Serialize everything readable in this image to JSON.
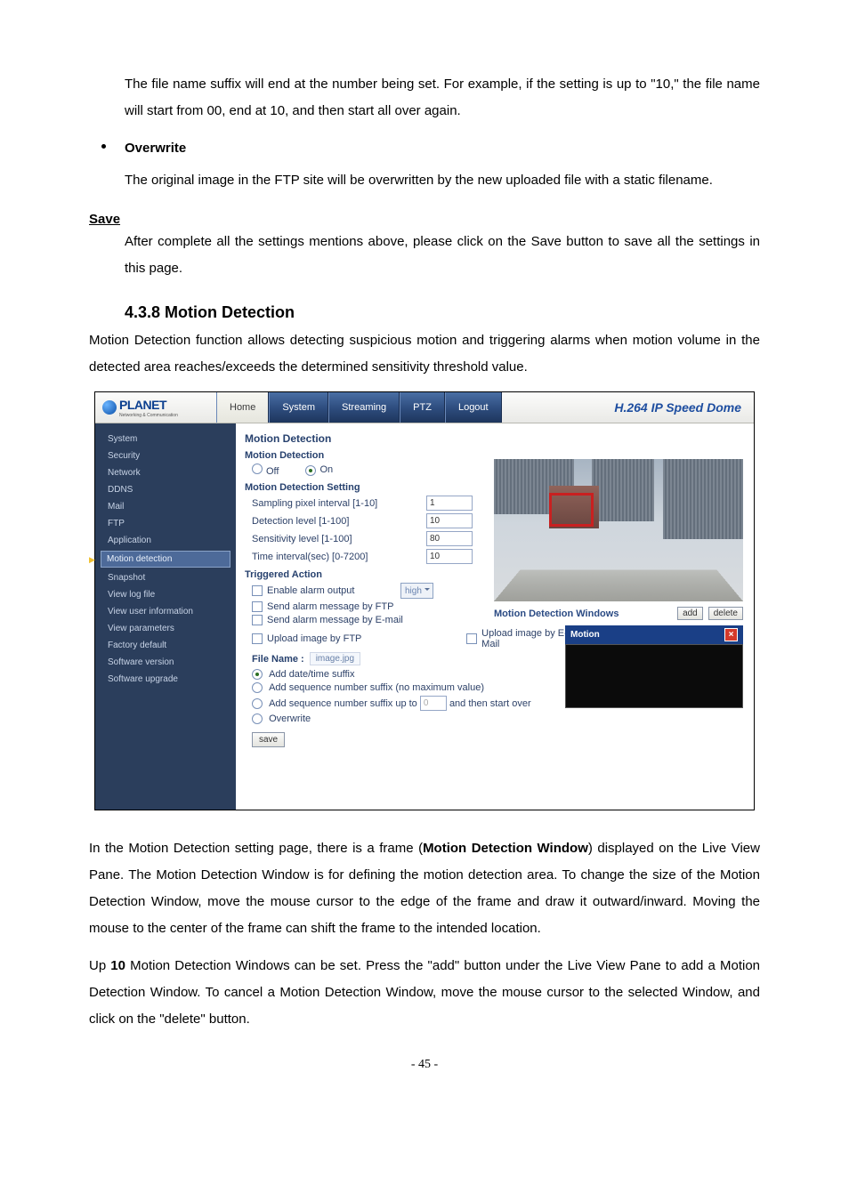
{
  "para1": "The file name suffix will end at the number being set. For example, if the setting is up to \"10,\" the file name will start from 00, end at 10, and then start all over again.",
  "bullet_overwrite": "Overwrite",
  "para_overwrite": "The original image in the FTP site will be overwritten by the new uploaded file with a static filename.",
  "save_h": "Save",
  "para_save": "After complete all the settings mentions above, please click on the Save button to save all the settings in this page.",
  "secnum": "4.3.8  Motion Detection",
  "para_md_intro": "Motion Detection function allows detecting suspicious motion and triggering alarms when motion volume in the detected area reaches/exceeds the determined sensitivity threshold value.",
  "logo": "PLANET",
  "logo_sub": "Networking & Communication",
  "nav": {
    "home": "Home",
    "system": "System",
    "streaming": "Streaming",
    "ptz": "PTZ",
    "logout": "Logout"
  },
  "brand": "H.264 IP Speed Dome",
  "side": [
    "System",
    "Security",
    "Network",
    "DDNS",
    "Mail",
    "FTP",
    "Application",
    "Motion detection",
    "Snapshot",
    "View log file",
    "View user information",
    "View parameters",
    "Factory default",
    "Software version",
    "Software upgrade"
  ],
  "ct": {
    "h1": "Motion Detection",
    "h2": "Motion Detection",
    "off": "Off",
    "on": "On",
    "h3": "Motion Detection Setting",
    "r1": "Sampling pixel interval [1-10]",
    "v1": "1",
    "r2": "Detection level [1-100]",
    "v2": "10",
    "r3": "Sensitivity level [1-100]",
    "v3": "80",
    "r4": "Time interval(sec) [0-7200]",
    "v4": "10",
    "h4": "Triggered Action",
    "c1": "Enable alarm output",
    "sel": "high",
    "c2": "Send alarm message by FTP",
    "c3": "Send alarm message by E-mail",
    "c4": "Upload image by FTP",
    "c5": "Upload image by E-Mail",
    "fn_t": "File Name :",
    "fn_v": "image.jpg",
    "o1": "Add date/time suffix",
    "o2": "Add sequence number suffix (no maximum value)",
    "o3a": "Add sequence number suffix up to",
    "o3v": "0",
    "o3b": "and then start over",
    "o4": "Overwrite",
    "save": "save"
  },
  "mdw": "Motion Detection Windows",
  "btn_add": "add",
  "btn_del": "delete",
  "mot_title": "Motion",
  "para_after1": "In the Motion Detection setting page, there is a frame (",
  "para_after1b": "Motion Detection Window",
  "para_after1c": ") displayed on the Live View Pane. The Motion Detection Window is for defining the motion detection area. To change the size of the Motion Detection Window, move the mouse cursor to the edge of the frame and draw it outward/inward. Moving the mouse to the center of the frame can shift the frame to the intended location.",
  "para_after2a": "Up ",
  "para_after2b": "10",
  "para_after2c": " Motion Detection Windows can be set. Press the \"add\" button under the Live View Pane to add a Motion Detection Window. To cancel a Motion Detection Window, move the mouse cursor to the selected Window, and click on the \"delete\" button.",
  "pgnum": "- 45 -"
}
